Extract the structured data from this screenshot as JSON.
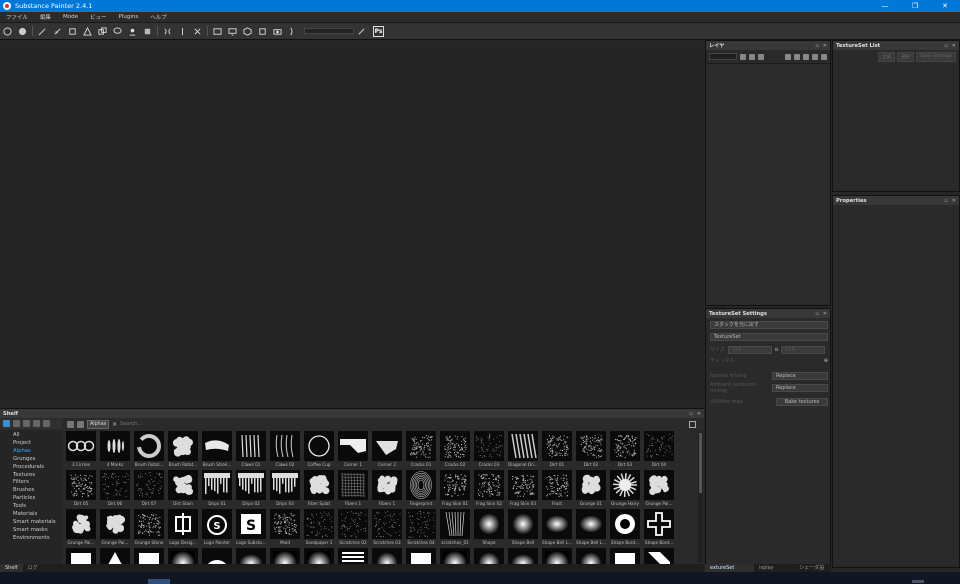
{
  "window": {
    "title": "Substance Painter 2.4.1",
    "minimize": "—",
    "maximize": "❐",
    "close": "✕"
  },
  "menu": [
    "ファイル",
    "編集",
    "Mode",
    "ビュー",
    "Plugins",
    "ヘルプ"
  ],
  "toolbar": {
    "ps_label": "Ps"
  },
  "layers": {
    "title": "レイヤ"
  },
  "texture_set_list": {
    "title": "TextureSet List",
    "buttons": [
      "全部",
      "選択",
      "Open Settings"
    ]
  },
  "properties": {
    "title": "Properties"
  },
  "texture_set_settings": {
    "title": "TextureSet Settings",
    "stack_button": "スタックを元に戻す",
    "name_field": "TextureSet",
    "size_label": "サイズ",
    "size_value": "256",
    "size_value2": "128",
    "channels_label": "チャンネル",
    "normal_label": "Normal mixing",
    "normal_value": "Replace",
    "ao_label": "Ambient occlusion mixing",
    "ao_value": "Replace",
    "uv_label": "UV/Wire map",
    "bake_button": "Bake textures"
  },
  "right_tabs": [
    "extureSet Setting",
    "isplay Setting",
    "シェーダ設定"
  ],
  "shelf": {
    "title": "Shelf",
    "categories": [
      "All",
      "Project",
      "Alphas",
      "Grunges",
      "Procedurals",
      "Textures",
      "Filters",
      "Brushes",
      "Particles",
      "Tools",
      "Materials",
      "Smart materials",
      "Smart masks",
      "Environments"
    ],
    "selected_category": "Alphas",
    "filter_tag": "Alphas",
    "search_placeholder": "Search...",
    "items": [
      {
        "label": "3 Circles",
        "kind": "circles3"
      },
      {
        "label": "4 Marks",
        "kind": "marks4"
      },
      {
        "label": "Brush Rotat...",
        "kind": "swirl"
      },
      {
        "label": "Brush Rotat...",
        "kind": "blob"
      },
      {
        "label": "Brush Strok...",
        "kind": "stroke"
      },
      {
        "label": "Claws 01",
        "kind": "claws"
      },
      {
        "label": "Claws 02",
        "kind": "claws2"
      },
      {
        "label": "Coffee Cup",
        "kind": "ring"
      },
      {
        "label": "Corner 1",
        "kind": "corner"
      },
      {
        "label": "Corner 2",
        "kind": "corner2"
      },
      {
        "label": "Cracks 01",
        "kind": "noise"
      },
      {
        "label": "Cracks 02",
        "kind": "noise"
      },
      {
        "label": "Cracks 03",
        "kind": "noise2"
      },
      {
        "label": "Diagonal Dri...",
        "kind": "drip"
      },
      {
        "label": "Dirt 01",
        "kind": "noise"
      },
      {
        "label": "Dirt 02",
        "kind": "noise"
      },
      {
        "label": "Dirt 03",
        "kind": "noise"
      },
      {
        "label": "Dirt 04",
        "kind": "noise2"
      },
      {
        "label": "Dirt 05",
        "kind": "noise"
      },
      {
        "label": "Dirt 06",
        "kind": "noise2"
      },
      {
        "label": "Dirt 07",
        "kind": "noise2"
      },
      {
        "label": "Dirt Stain",
        "kind": "blob"
      },
      {
        "label": "Drips 01",
        "kind": "drips"
      },
      {
        "label": "Drips 02",
        "kind": "drips"
      },
      {
        "label": "Drips 03",
        "kind": "drips"
      },
      {
        "label": "Fiber Splat",
        "kind": "blob"
      },
      {
        "label": "Fibers 1",
        "kind": "fibers"
      },
      {
        "label": "Fibers 1",
        "kind": "blob"
      },
      {
        "label": "Fingerprint",
        "kind": "finger"
      },
      {
        "label": "Frag Skin 01",
        "kind": "noise"
      },
      {
        "label": "Frag Skin 02",
        "kind": "noise"
      },
      {
        "label": "Frag Skin 03",
        "kind": "noise"
      },
      {
        "label": "Frost",
        "kind": "noise"
      },
      {
        "label": "Grunge 01",
        "kind": "blob"
      },
      {
        "label": "Grunge Hairy",
        "kind": "splat"
      },
      {
        "label": "Grunge Pai...",
        "kind": "blob"
      },
      {
        "label": "Grunge Pai...",
        "kind": "blob"
      },
      {
        "label": "Grunge Pai...",
        "kind": "blob"
      },
      {
        "label": "Grunge Stone",
        "kind": "noise"
      },
      {
        "label": "Logo Desig...",
        "kind": "logo1"
      },
      {
        "label": "Logo Painter",
        "kind": "logo2"
      },
      {
        "label": "Logo Substa...",
        "kind": "logoS"
      },
      {
        "label": "Mold",
        "kind": "noise"
      },
      {
        "label": "Sandpaper 1",
        "kind": "noise2"
      },
      {
        "label": "Scratches 02",
        "kind": "noise2"
      },
      {
        "label": "Scratches 03",
        "kind": "noise2"
      },
      {
        "label": "Scratches 04",
        "kind": "noise2"
      },
      {
        "label": "scratches_01",
        "kind": "scratch"
      },
      {
        "label": "Shape",
        "kind": "softdot"
      },
      {
        "label": "Shape Bell",
        "kind": "softdot"
      },
      {
        "label": "Shape Bell L...",
        "kind": "softdot2"
      },
      {
        "label": "Shape Bell L...",
        "kind": "softdot2"
      },
      {
        "label": "Shape Bord...",
        "kind": "donut"
      },
      {
        "label": "Shape Bord...",
        "kind": "cross"
      },
      {
        "label": "",
        "kind": "square"
      },
      {
        "label": "",
        "kind": "triangle"
      },
      {
        "label": "",
        "kind": "square"
      },
      {
        "label": "",
        "kind": "softsq"
      },
      {
        "label": "",
        "kind": "halfdisc"
      },
      {
        "label": "",
        "kind": "softdot2"
      },
      {
        "label": "",
        "kind": "softsq"
      },
      {
        "label": "",
        "kind": "softsq"
      },
      {
        "label": "",
        "kind": "stripes"
      },
      {
        "label": "",
        "kind": "softdot"
      },
      {
        "label": "",
        "kind": "square"
      },
      {
        "label": "",
        "kind": "softsq"
      },
      {
        "label": "",
        "kind": "softdot"
      },
      {
        "label": "",
        "kind": "softdot2"
      },
      {
        "label": "",
        "kind": "softsq"
      },
      {
        "label": "",
        "kind": "softdot"
      },
      {
        "label": "",
        "kind": "square"
      },
      {
        "label": "",
        "kind": "diag"
      }
    ]
  },
  "shelf_tabs": [
    "Shelf",
    "ログ"
  ],
  "colors": {
    "accent": "#0078d7",
    "selection": "#35a8ff"
  }
}
